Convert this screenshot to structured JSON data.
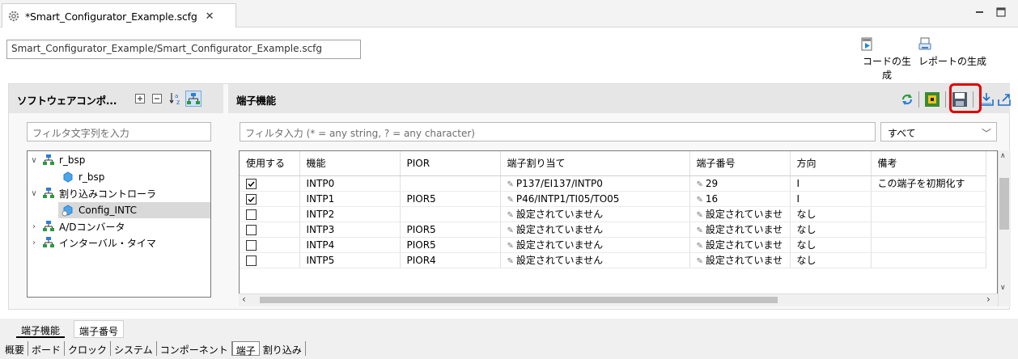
{
  "tab": {
    "title": "*Smart_Configurator_Example.scfg",
    "close": "✕"
  },
  "tooltip": "Smart_Configurator_Example/Smart_Configurator_Example.scfg",
  "toolbar": {
    "gen_code": "コードの生成",
    "gen_report": "レポートの生成"
  },
  "left_panel": {
    "title": "ソフトウェアコンポ...",
    "filter_placeholder": "フィルタ文字列を入力",
    "tree": [
      {
        "label": "r_bsp"
      },
      {
        "label": "r_bsp"
      },
      {
        "label": "割り込みコントローラ"
      },
      {
        "label": "Config_INTC"
      },
      {
        "label": "A/Dコンバータ"
      },
      {
        "label": "インターバル・タイマ"
      }
    ]
  },
  "right_panel": {
    "title": "端子機能",
    "filter_placeholder": "フィルタ入力 (* = any string, ? = any character)",
    "select_value": "すべて",
    "columns": [
      "使用する",
      "機能",
      "PIOR",
      "端子割り当て",
      "端子番号",
      "方向",
      "備考"
    ],
    "rows": [
      {
        "use": true,
        "func": "INTP0",
        "pior": "",
        "assign": "P137/EI137/INTP0",
        "pin": "29",
        "dir": "I",
        "note": "この端子を初期化す"
      },
      {
        "use": true,
        "func": "INTP1",
        "pior": "PIOR5",
        "assign": "P46/INTP1/TI05/TO05",
        "pin": "16",
        "dir": "I",
        "note": ""
      },
      {
        "use": false,
        "func": "INTP2",
        "pior": "",
        "assign": "設定されていません",
        "pin": "設定されていませ",
        "dir": "なし",
        "note": ""
      },
      {
        "use": false,
        "func": "INTP3",
        "pior": "PIOR5",
        "assign": "設定されていません",
        "pin": "設定されていませ",
        "dir": "なし",
        "note": ""
      },
      {
        "use": false,
        "func": "INTP4",
        "pior": "PIOR5",
        "assign": "設定されていません",
        "pin": "設定されていませ",
        "dir": "なし",
        "note": ""
      },
      {
        "use": false,
        "func": "INTP5",
        "pior": "PIOR4",
        "assign": "設定されていません",
        "pin": "設定されていませ",
        "dir": "なし",
        "note": ""
      }
    ]
  },
  "sub_tabs": [
    "端子機能",
    "端子番号"
  ],
  "page_tabs": [
    "概要",
    "ボード",
    "クロック",
    "システム",
    "コンポーネント",
    "端子",
    "割り込み"
  ],
  "colors": {
    "highlight": "#e00000",
    "accent": "#2a7fd4"
  },
  "icons": [
    "gear-icon",
    "close-icon",
    "minimize-icon",
    "maximize-icon",
    "generate-code-icon",
    "generate-report-icon",
    "expand-all-icon",
    "collapse-all-icon",
    "sort-icon",
    "hierarchy-icon",
    "refresh-icon",
    "board-icon",
    "save-icon",
    "import-icon",
    "export-icon",
    "component-icon"
  ]
}
